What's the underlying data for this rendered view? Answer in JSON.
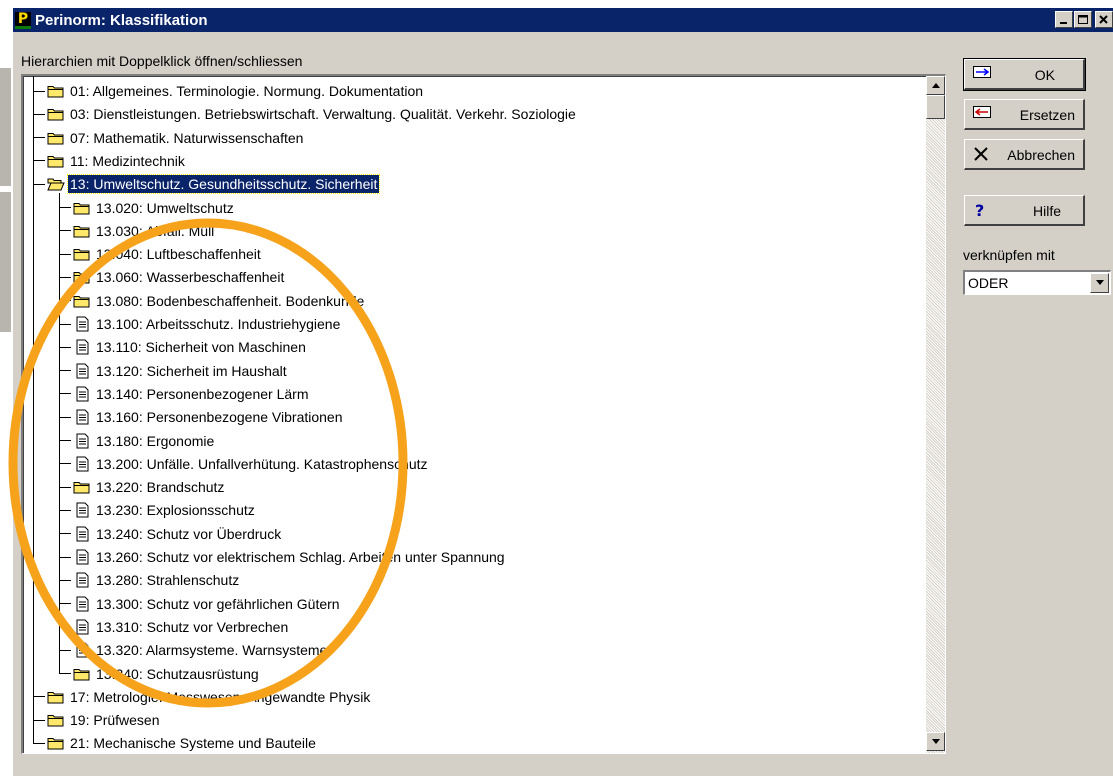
{
  "window": {
    "title": "Perinorm: Klassifikation",
    "app_icon_letter": "P",
    "titlebar_color": "#0a246a",
    "controls": [
      "minimize-icon",
      "maximize-icon",
      "close-icon"
    ]
  },
  "tree_panel": {
    "hint": "Hierarchien mit Doppelklick öffnen/schliessen",
    "items": [
      {
        "level": 0,
        "icon": "folder-closed-icon",
        "label": "01: Allgemeines. Terminologie. Normung. Dokumentation"
      },
      {
        "level": 0,
        "icon": "folder-closed-icon",
        "label": "03: Dienstleistungen. Betriebswirtschaft. Verwaltung. Qualität. Verkehr. Soziologie"
      },
      {
        "level": 0,
        "icon": "folder-closed-icon",
        "label": "07: Mathematik. Naturwissenschaften"
      },
      {
        "level": 0,
        "icon": "folder-closed-icon",
        "label": "11: Medizintechnik"
      },
      {
        "level": 0,
        "icon": "folder-open-icon",
        "label": "13: Umweltschutz. Gesundheitsschutz. Sicherheit",
        "selected": true
      },
      {
        "level": 1,
        "icon": "folder-closed-icon",
        "label": "13.020: Umweltschutz"
      },
      {
        "level": 1,
        "icon": "folder-closed-icon",
        "label": "13.030: Abfall. Müll"
      },
      {
        "level": 1,
        "icon": "folder-closed-icon",
        "label": "13.040: Luftbeschaffenheit"
      },
      {
        "level": 1,
        "icon": "folder-closed-icon",
        "label": "13.060: Wasserbeschaffenheit"
      },
      {
        "level": 1,
        "icon": "folder-closed-icon",
        "label": "13.080: Bodenbeschaffenheit. Bodenkunde"
      },
      {
        "level": 1,
        "icon": "document-icon",
        "label": "13.100: Arbeitsschutz. Industriehygiene"
      },
      {
        "level": 1,
        "icon": "document-icon",
        "label": "13.110: Sicherheit von Maschinen"
      },
      {
        "level": 1,
        "icon": "document-icon",
        "label": "13.120: Sicherheit im Haushalt"
      },
      {
        "level": 1,
        "icon": "document-icon",
        "label": "13.140: Personenbezogener Lärm"
      },
      {
        "level": 1,
        "icon": "document-icon",
        "label": "13.160: Personenbezogene Vibrationen"
      },
      {
        "level": 1,
        "icon": "document-icon",
        "label": "13.180: Ergonomie"
      },
      {
        "level": 1,
        "icon": "document-icon",
        "label": "13.200: Unfälle. Unfallverhütung. Katastrophenschutz"
      },
      {
        "level": 1,
        "icon": "folder-closed-icon",
        "label": "13.220: Brandschutz"
      },
      {
        "level": 1,
        "icon": "document-icon",
        "label": "13.230: Explosionsschutz"
      },
      {
        "level": 1,
        "icon": "document-icon",
        "label": "13.240: Schutz vor Überdruck"
      },
      {
        "level": 1,
        "icon": "document-icon",
        "label": "13.260: Schutz vor elektrischem Schlag. Arbeiten unter Spannung"
      },
      {
        "level": 1,
        "icon": "document-icon",
        "label": "13.280: Strahlenschutz"
      },
      {
        "level": 1,
        "icon": "document-icon",
        "label": "13.300: Schutz vor gefährlichen Gütern"
      },
      {
        "level": 1,
        "icon": "document-icon",
        "label": "13.310: Schutz vor Verbrechen"
      },
      {
        "level": 1,
        "icon": "document-icon",
        "label": "13.320: Alarmsysteme. Warnsysteme"
      },
      {
        "level": 1,
        "icon": "folder-closed-icon",
        "label": "13.340: Schutzausrüstung"
      },
      {
        "level": 0,
        "icon": "folder-closed-icon",
        "label": "17: Metrologie. Messwesen. Angewandte Physik"
      },
      {
        "level": 0,
        "icon": "folder-closed-icon",
        "label": "19: Prüfwesen"
      },
      {
        "level": 0,
        "icon": "folder-closed-icon",
        "label": "21: Mechanische Systeme und Bauteile"
      }
    ]
  },
  "buttons": {
    "ok": {
      "label": "OK",
      "icon": "apply-icon"
    },
    "replace": {
      "label": "Ersetzen",
      "icon": "replace-icon"
    },
    "cancel": {
      "label": "Abbrechen",
      "icon": "x-icon"
    },
    "help": {
      "label": "Hilfe",
      "icon": "question-icon"
    }
  },
  "link_with": {
    "label": "verknüpfen mit",
    "selected": "ODER"
  },
  "colors": {
    "selection": "#0a246a",
    "annotation_ring": "#f7a21b",
    "folder": "#ffe86a"
  }
}
